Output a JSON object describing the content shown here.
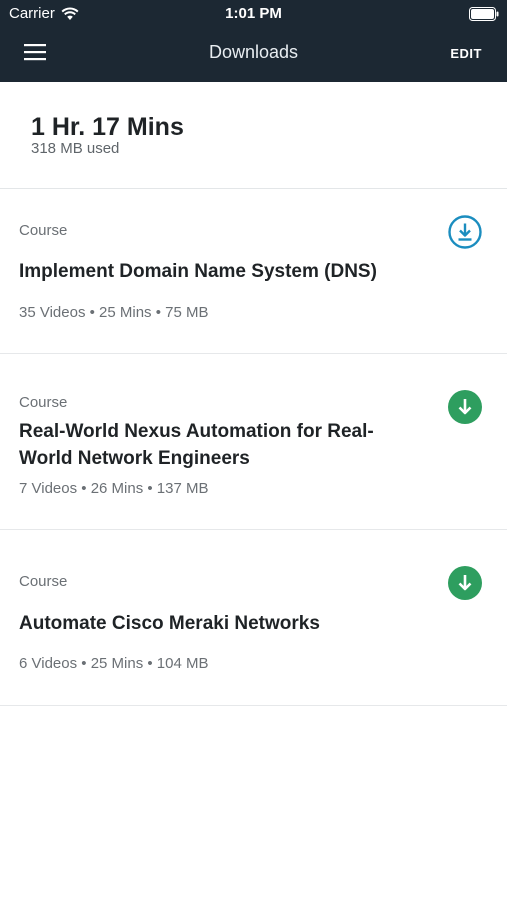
{
  "status_bar": {
    "carrier": "Carrier",
    "time": "1:01 PM"
  },
  "nav": {
    "title": "Downloads",
    "edit_label": "EDIT",
    "menu_icon": "hamburger-menu-icon"
  },
  "summary": {
    "duration": "1 Hr. 17 Mins",
    "storage_used": "318 MB used"
  },
  "courses": [
    {
      "type": "Course",
      "title": "Implement Domain Name System (DNS)",
      "meta": "35 Videos • 25 Mins • 75 MB",
      "status_icon": "download-outline-icon"
    },
    {
      "type": "Course",
      "title": "Real-World Nexus Automation for Real-World Network Engineers",
      "meta": "7 Videos • 26 Mins • 137 MB",
      "status_icon": "downloaded-check-icon"
    },
    {
      "type": "Course",
      "title": "Automate Cisco Meraki Networks",
      "meta": "6 Videos • 25 Mins • 104 MB",
      "status_icon": "downloaded-check-icon"
    }
  ],
  "colors": {
    "header_bg": "#1c2833",
    "download_outline": "#1b8dbf",
    "downloaded_green": "#2e9e5f"
  }
}
